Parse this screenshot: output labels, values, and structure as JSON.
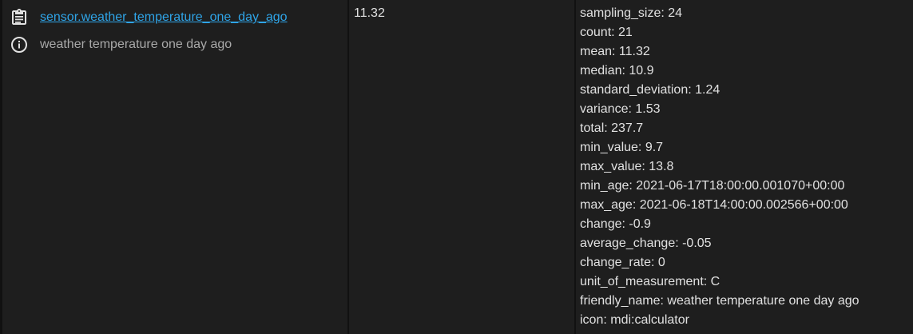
{
  "entity": {
    "entity_id": "sensor.weather_temperature_one_day_ago",
    "friendly_name": "weather temperature one day ago",
    "copy_icon": "clipboard-copy-icon",
    "info_icon": "information-outline-icon"
  },
  "state": {
    "value": "11.32"
  },
  "attributes": [
    "sampling_size: 24",
    "count: 21",
    "mean: 11.32",
    "median: 10.9",
    "standard_deviation: 1.24",
    "variance: 1.53",
    "total: 237.7",
    "min_value: 9.7",
    "max_value: 13.8",
    "min_age: 2021-06-17T18:00:00.001070+00:00",
    "max_age: 2021-06-18T14:00:00.002566+00:00",
    "change: -0.9",
    "average_change: -0.05",
    "change_rate: 0",
    "unit_of_measurement: C",
    "friendly_name: weather temperature one day ago",
    "icon: mdi:calculator"
  ],
  "colors": {
    "link": "#2fa4e7",
    "muted_text": "#a9a9a9",
    "background": "#1e1e1e",
    "divider": "#111111"
  }
}
